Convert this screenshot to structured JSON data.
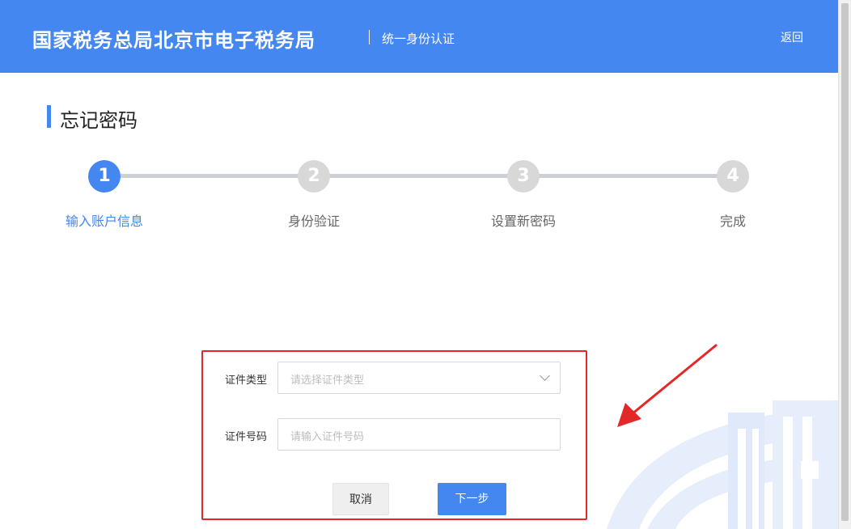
{
  "header": {
    "site_title": "国家税务总局北京市电子税务局",
    "subtitle": "统一身份认证",
    "back_label": "返回",
    "bg_color": "#4587f0"
  },
  "page": {
    "title": "忘记密码"
  },
  "steps": [
    {
      "number": "1",
      "label": "输入账户信息",
      "state": "active"
    },
    {
      "number": "2",
      "label": "身份验证",
      "state": "inactive"
    },
    {
      "number": "3",
      "label": "设置新密码",
      "state": "inactive"
    },
    {
      "number": "4",
      "label": "完成",
      "state": "inactive"
    }
  ],
  "form": {
    "id_type_label": "证件类型",
    "id_type_placeholder": "请选择证件类型",
    "id_number_label": "证件号码",
    "id_number_placeholder": "请输入证件号码",
    "cancel_label": "取消",
    "next_label": "下一步"
  },
  "colors": {
    "accent": "#4587f0",
    "highlight_border": "#e32828",
    "inactive_step": "#d8d8d8"
  }
}
